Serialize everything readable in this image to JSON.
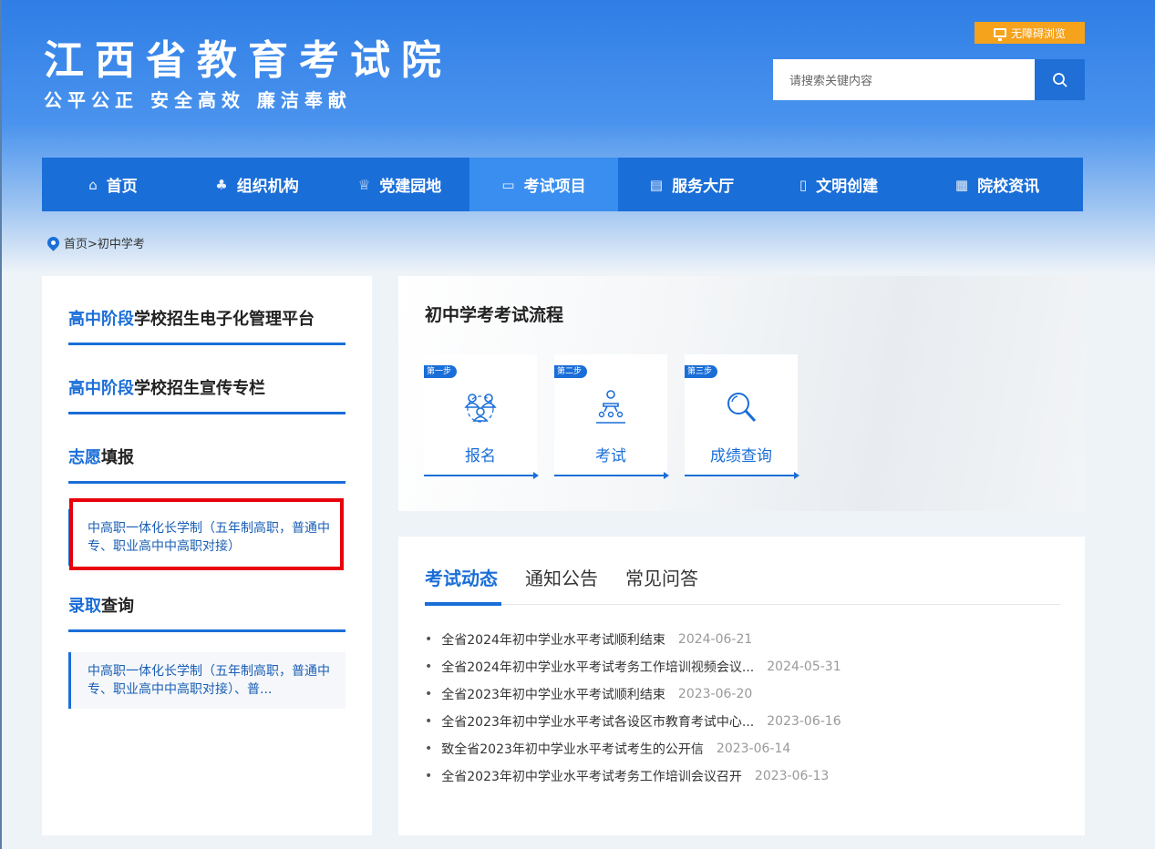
{
  "header": {
    "title": "江西省教育考试院",
    "slogan": "公平公正  安全高效  廉洁奉献",
    "accessibility_label": "无障碍浏览",
    "search_placeholder": "请搜索关键内容"
  },
  "nav": [
    {
      "icon": "home-icon",
      "glyph": "⌂",
      "label": "首页"
    },
    {
      "icon": "org-chart-icon",
      "glyph": "♣",
      "label": "组织机构"
    },
    {
      "icon": "party-icon",
      "glyph": "♕",
      "label": "党建园地"
    },
    {
      "icon": "book-icon",
      "glyph": "▭",
      "label": "考试项目"
    },
    {
      "icon": "chat-icon",
      "glyph": "▤",
      "label": "服务大厅"
    },
    {
      "icon": "document-icon",
      "glyph": "▯",
      "label": "文明创建"
    },
    {
      "icon": "news-icon",
      "glyph": "▦",
      "label": "院校资讯"
    }
  ],
  "breadcrumb": "首页>初中学考",
  "sidebar": {
    "sections": [
      {
        "highlight": "高中阶段",
        "rest": "学校招生电子化管理平台"
      },
      {
        "highlight": "高中阶段",
        "rest": "学校招生宣传专栏"
      },
      {
        "highlight": "志愿",
        "rest": "填报"
      },
      {
        "highlight": "录取",
        "rest": "查询"
      }
    ],
    "volunteer_link": "中高职一体化长学制（五年制高职，普通中专、职业高中中高职对接）",
    "admission_link": "中高职一体化长学制（五年制高职，普通中专、职业高中中高职对接）、普..."
  },
  "process": {
    "title": "初中学考考试流程",
    "steps": [
      {
        "badge": "第一步",
        "label": "报名",
        "icon": "people-icon"
      },
      {
        "badge": "第二步",
        "label": "考试",
        "icon": "exam-icon"
      },
      {
        "badge": "第三步",
        "label": "成绩查询",
        "icon": "magnifier-icon"
      }
    ]
  },
  "news": {
    "tabs": [
      "考试动态",
      "通知公告",
      "常见问答"
    ],
    "items": [
      {
        "title": "全省2024年初中学业水平考试顺利结束",
        "date": "2024-06-21"
      },
      {
        "title": "全省2024年初中学业水平考试考务工作培训视频会议...",
        "date": "2024-05-31"
      },
      {
        "title": "全省2023年初中学业水平考试顺利结束",
        "date": "2023-06-20"
      },
      {
        "title": "全省2023年初中学业水平考试各设区市教育考试中心...",
        "date": "2023-06-16"
      },
      {
        "title": "致全省2023年初中学业水平考试考生的公开信",
        "date": "2023-06-14"
      },
      {
        "title": "全省2023年初中学业水平考试考务工作培训会议召开",
        "date": "2023-06-13"
      }
    ]
  },
  "colors": {
    "primary": "#1a6ed8",
    "accent": "#f5a21c",
    "highlight_box": "#e8000b"
  }
}
